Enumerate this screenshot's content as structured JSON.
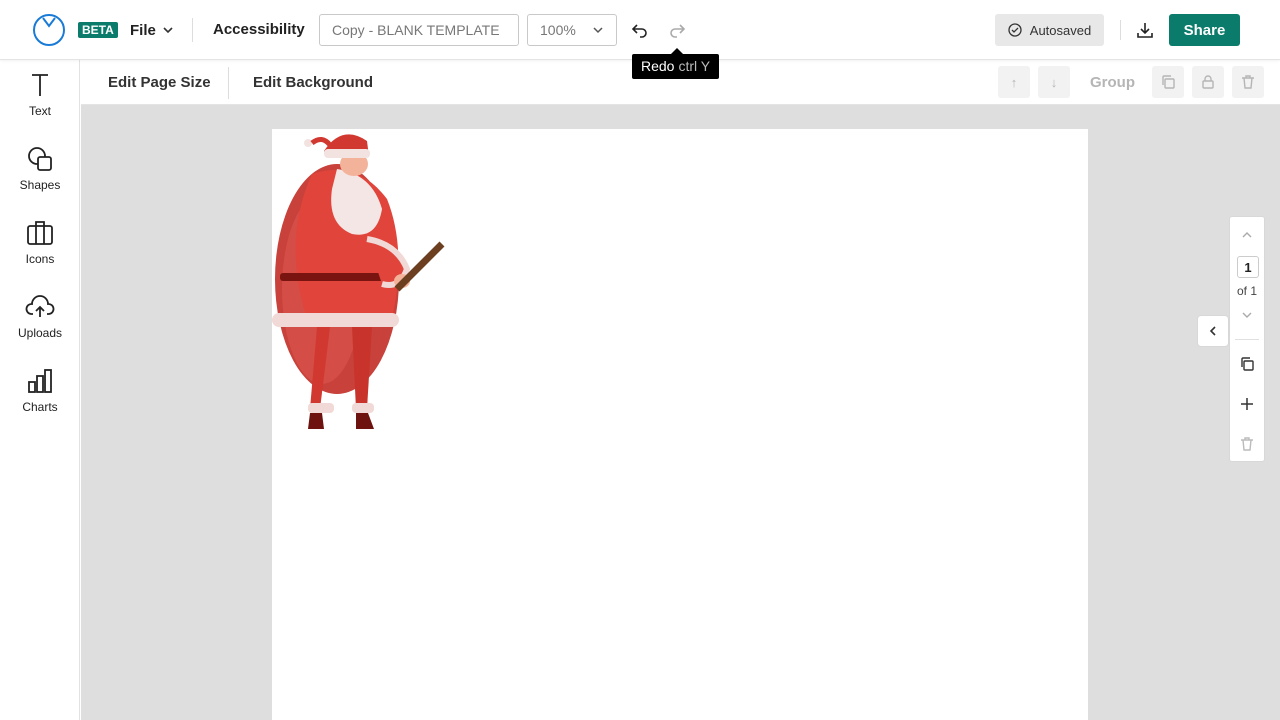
{
  "header": {
    "beta_badge": "BETA",
    "file_label": "File",
    "accessibility_label": "Accessibility",
    "document_title": "Copy - BLANK TEMPLATE",
    "zoom_value": "100%",
    "tooltip": {
      "label": "Redo",
      "shortcut": "ctrl Y"
    },
    "autosaved_label": "Autosaved",
    "share_label": "Share"
  },
  "sidebar": {
    "items": [
      {
        "label": "Text",
        "icon": "text-icon"
      },
      {
        "label": "Shapes",
        "icon": "shapes-icon"
      },
      {
        "label": "Icons",
        "icon": "briefcase-icon"
      },
      {
        "label": "Uploads",
        "icon": "cloud-upload-icon"
      },
      {
        "label": "Charts",
        "icon": "bar-chart-icon"
      }
    ]
  },
  "toolbar": {
    "edit_page_size": "Edit Page Size",
    "edit_background": "Edit Background",
    "move_up": "↑",
    "move_down": "↓",
    "group_label": "Group"
  },
  "page_panel": {
    "current_page": "1",
    "page_total": "of 1"
  },
  "colors": {
    "brand": "#0b7c6b",
    "logo_blue": "#1a7bd6",
    "workspace": "#dedede"
  }
}
